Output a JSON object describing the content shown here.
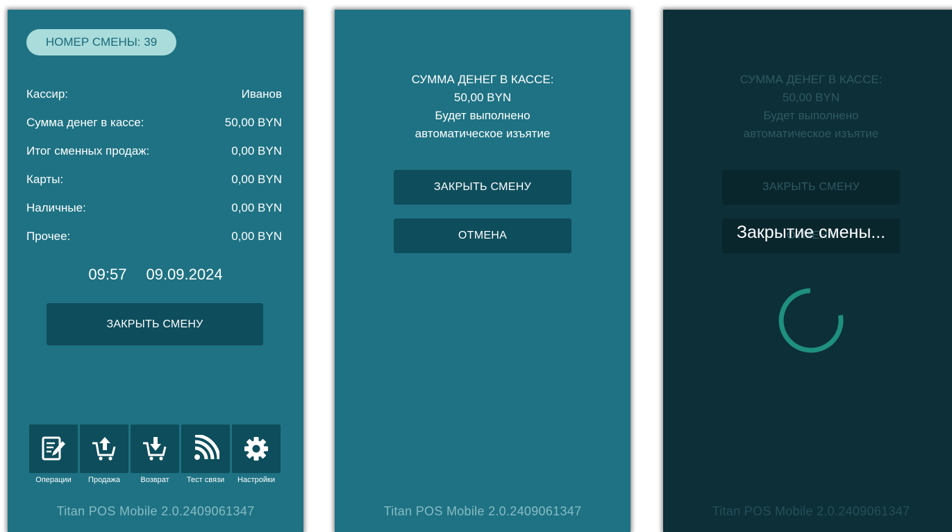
{
  "screen1": {
    "shift_number": "НОМЕР СМЕНЫ: 39",
    "rows": [
      {
        "label": "Кассир:",
        "value": "Иванов"
      },
      {
        "label": "Сумма денег в кассе:",
        "value": "50,00 BYN"
      },
      {
        "label": "Итог сменных продаж:",
        "value": "0,00 BYN"
      },
      {
        "label": "Карты:",
        "value": "0,00 BYN"
      },
      {
        "label": "Наличные:",
        "value": "0,00 BYN"
      },
      {
        "label": "Прочее:",
        "value": "0,00 BYN"
      }
    ],
    "time": "09:57",
    "date": "09.09.2024",
    "close_shift_label": "ЗАКРЫТЬ СМЕНУ",
    "tabs": [
      {
        "label": "Операции",
        "icon": "edit-document-icon"
      },
      {
        "label": "Продажа",
        "icon": "cart-upload-icon"
      },
      {
        "label": "Возврат",
        "icon": "cart-download-icon"
      },
      {
        "label": "Тест связи",
        "icon": "signal-icon"
      },
      {
        "label": "Настройки",
        "icon": "gear-icon"
      }
    ],
    "version": "Titan POS Mobile 2.0.2409061347"
  },
  "screen2": {
    "message": [
      "СУММА ДЕНЕГ В КАССЕ:",
      "50,00 BYN",
      "Будет выполнено",
      "автоматическое изъятие"
    ],
    "close_shift_label": "ЗАКРЫТЬ СМЕНУ",
    "cancel_label": "ОТМЕНА",
    "version": "Titan POS Mobile 2.0.2409061347"
  },
  "screen3": {
    "message": [
      "СУММА ДЕНЕГ В КАССЕ:",
      "50,00 BYN",
      "Будет выполнено",
      "автоматическое изъятие"
    ],
    "close_shift_label": "ЗАКРЫТЬ СМЕНУ",
    "cancel_label": "ОТМЕНА",
    "loading_text": "Закрытие смены...",
    "version": "Titan POS Mobile 2.0.2409061347"
  },
  "colors": {
    "background": "#1e7283",
    "button": "#0e4d5c",
    "pill": "#a9dcdb",
    "overlay": "#0d2f37",
    "spinner": "#1f8f7f"
  }
}
